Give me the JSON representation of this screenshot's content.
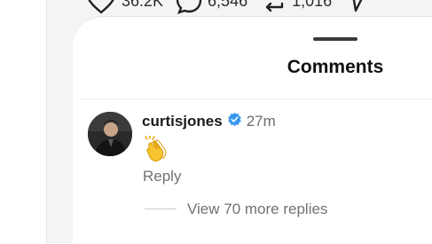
{
  "post": {
    "metrics": [
      {
        "icon": "heart-icon",
        "value": "36.2K"
      },
      {
        "icon": "comment-icon",
        "value": "6,546"
      },
      {
        "icon": "repost-icon",
        "value": "1,016"
      },
      {
        "icon": "share-icon",
        "value": ""
      }
    ]
  },
  "comments_sheet": {
    "title": "Comments",
    "comment": {
      "avatar": "avatar-photo",
      "username": "curtisjones",
      "verified_icon": "verified-badge-icon",
      "verified_color": "#3897f0",
      "timestamp": "27m",
      "body_emoji": "clapping-hands-emoji",
      "reply_label": "Reply",
      "view_replies_label": "View 70 more replies"
    }
  }
}
